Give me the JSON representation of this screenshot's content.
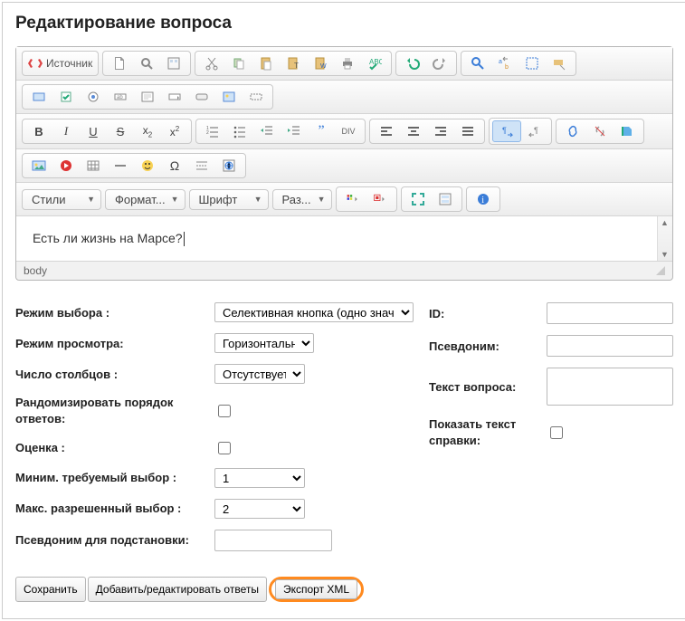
{
  "heading": "Редактирование вопроса",
  "toolbar": {
    "source_label": "Источник"
  },
  "combos": {
    "styles": "Стили",
    "format": "Формат...",
    "font": "Шрифт",
    "size": "Раз..."
  },
  "editor": {
    "content": "Есть ли жизнь на Марсе?",
    "path": "body"
  },
  "left": {
    "select_mode_label": "Режим выбора :",
    "select_mode_value": "Селективная кнопка (одно значение)",
    "view_mode_label": "Режим просмотра:",
    "view_mode_value": "Горизонтально",
    "columns_label": "Число столбцов :",
    "columns_value": "Отсутствует",
    "randomize_label": "Рандомизировать порядок ответов:",
    "score_label": "Оценка :",
    "min_label": "Миним. требуемый выбор :",
    "min_value": "1",
    "max_label": "Макс. разрешенный выбор :",
    "max_value": "2",
    "alias_sub_label": "Псевдоним для подстановки:"
  },
  "right": {
    "id_label": "ID:",
    "alias_label": "Псевдоним:",
    "qtext_label": "Текст вопроса:",
    "help_label": "Показать текст справки:"
  },
  "footer": {
    "save": "Сохранить",
    "edit_answers": "Добавить/редактировать ответы",
    "export_xml": "Экспорт XML"
  }
}
